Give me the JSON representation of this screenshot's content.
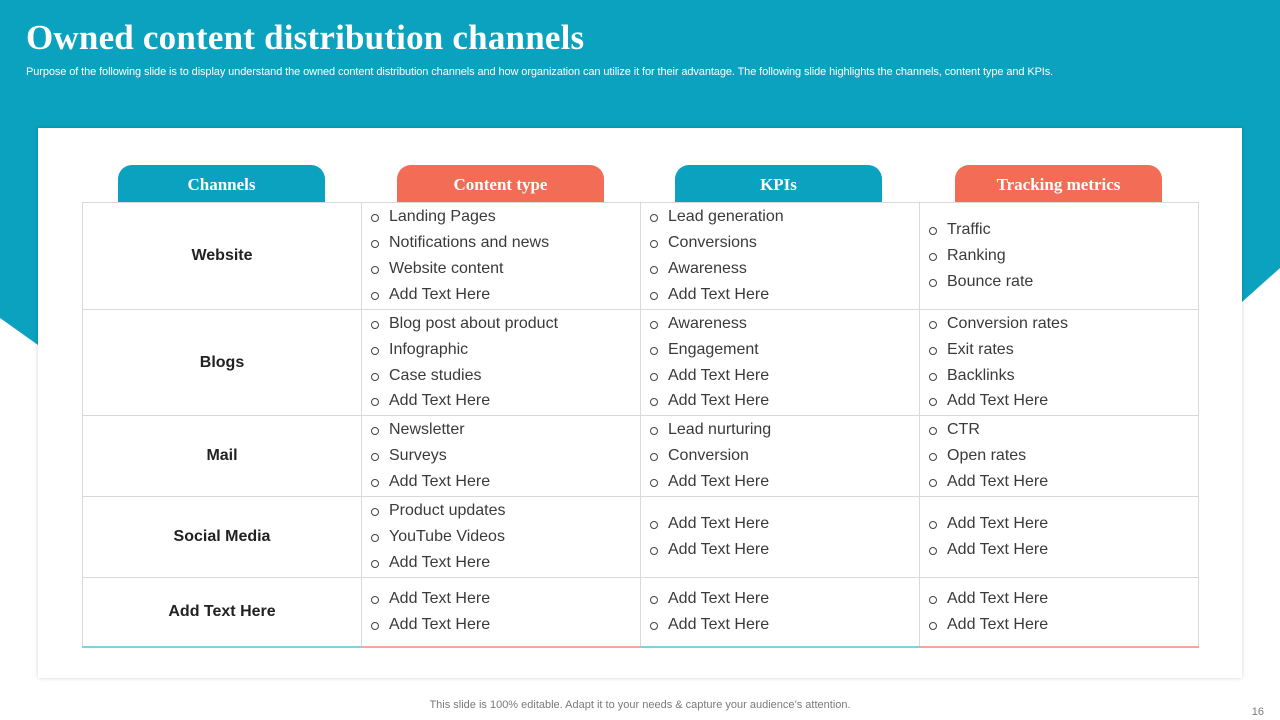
{
  "title": "Owned content distribution channels",
  "subtitle": "Purpose of the following slide is to display understand the owned content distribution channels and how organization can utilize it for their advantage. The following slide highlights the channels, content type and KPIs.",
  "colors": {
    "accent_teal": "#0aa2bf",
    "accent_coral": "#f26c56"
  },
  "headers": [
    "Channels",
    "Content type",
    "KPIs",
    "Tracking metrics"
  ],
  "rows": [
    {
      "channel": "Website",
      "content": [
        "Landing Pages",
        "Notifications and news",
        "Website content",
        "Add Text Here"
      ],
      "kpis": [
        "Lead generation",
        "Conversions",
        "Awareness",
        "Add Text Here"
      ],
      "metrics": [
        "Traffic",
        "Ranking",
        "Bounce rate"
      ]
    },
    {
      "channel": "Blogs",
      "content": [
        "Blog post about product",
        "Infographic",
        "Case studies",
        "Add Text Here"
      ],
      "kpis": [
        "Awareness",
        "Engagement",
        "Add Text Here",
        "Add Text Here"
      ],
      "metrics": [
        "Conversion rates",
        "Exit rates",
        "Backlinks",
        "Add Text Here"
      ]
    },
    {
      "channel": "Mail",
      "content": [
        "Newsletter",
        "Surveys",
        "Add Text Here"
      ],
      "kpis": [
        "Lead nurturing",
        "Conversion",
        "Add Text Here"
      ],
      "metrics": [
        "CTR",
        "Open rates",
        "Add Text Here"
      ]
    },
    {
      "channel": "Social Media",
      "content": [
        "Product updates",
        "YouTube  Videos",
        "Add Text Here"
      ],
      "kpis": [
        "Add Text Here",
        "Add Text Here"
      ],
      "metrics": [
        "Add Text Here",
        "Add Text Here"
      ]
    },
    {
      "channel": "Add Text Here",
      "content": [
        "Add Text Here",
        "Add Text Here"
      ],
      "kpis": [
        "Add Text Here",
        "Add Text Here"
      ],
      "metrics": [
        "Add Text Here",
        "Add Text Here"
      ]
    }
  ],
  "footer": "This slide is 100% editable. Adapt it to your needs & capture your audience’s attention.",
  "page_number": "16"
}
